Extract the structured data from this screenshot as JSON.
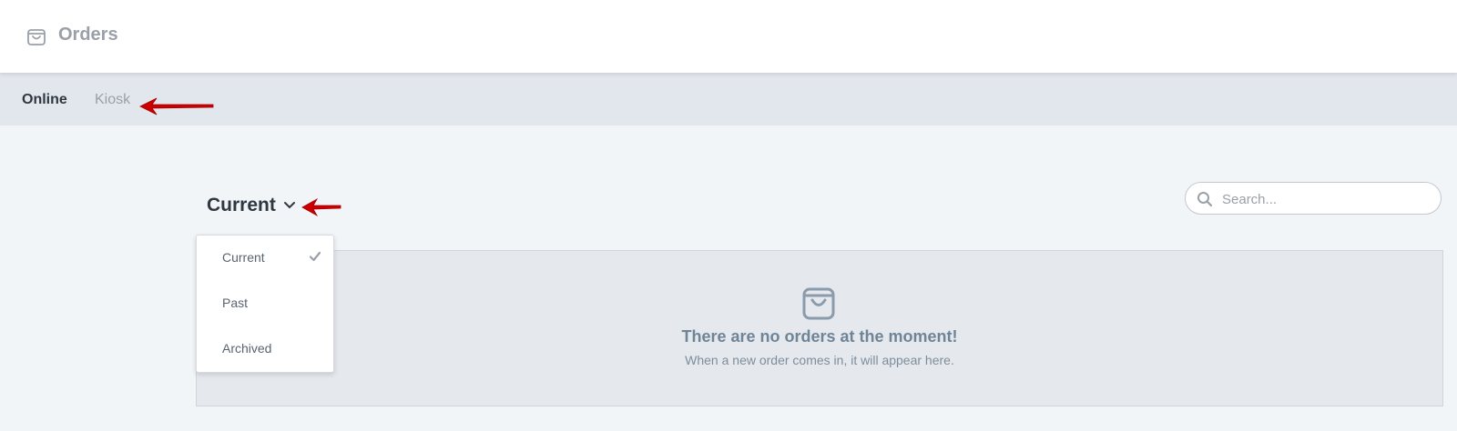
{
  "header": {
    "title": "Orders",
    "icon": "shopping-bag-icon"
  },
  "tabs": [
    {
      "label": "Online",
      "active": true
    },
    {
      "label": "Kiosk",
      "active": false
    }
  ],
  "filter": {
    "selected_label": "Current",
    "options": [
      {
        "label": "Current",
        "checked": true
      },
      {
        "label": "Past",
        "checked": false
      },
      {
        "label": "Archived",
        "checked": false
      }
    ]
  },
  "search": {
    "placeholder": "Search...",
    "value": ""
  },
  "empty_state": {
    "icon": "shopping-bag-icon",
    "title": "There are no orders at the moment!",
    "subtitle": "When a new order comes in, it will appear here."
  },
  "annotations": {
    "arrow_color": "#cc0000"
  }
}
